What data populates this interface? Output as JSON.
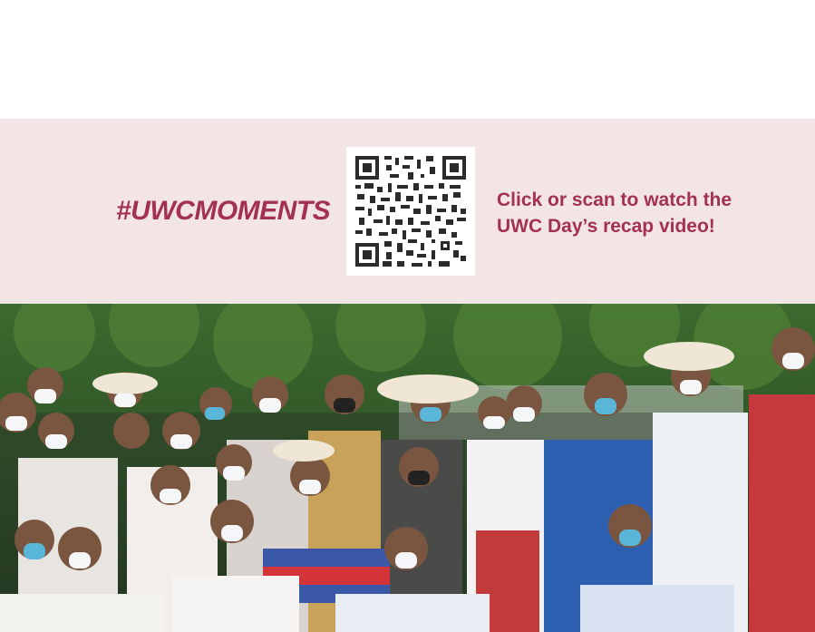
{
  "banner": {
    "hashtag": "#UWCMOMENTS",
    "cta_line1": "Click or scan to watch the",
    "cta_line2": "UWC Day’s recap video!",
    "accent_color": "#a33150",
    "background_color": "#f3e5e6"
  },
  "qr": {
    "icon": "qr-code-icon"
  },
  "photo": {
    "description_icon": "group-photo-image"
  }
}
